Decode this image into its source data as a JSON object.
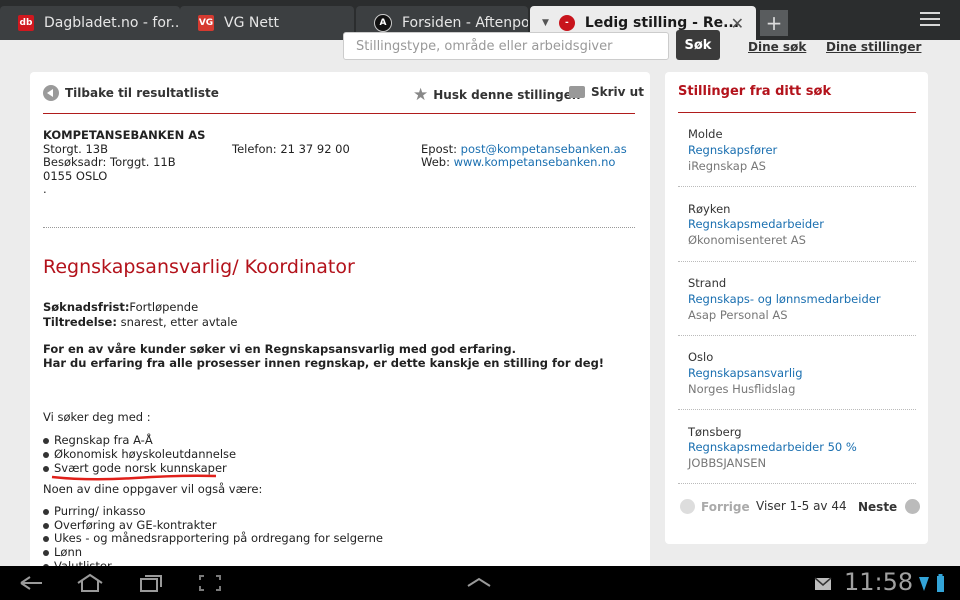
{
  "browser": {
    "tabs": [
      {
        "label": "Dagbladet.no - for...",
        "favicon": "db"
      },
      {
        "label": "VG Nett",
        "favicon": "VG"
      },
      {
        "label": "Forsiden - Aftenpo...",
        "favicon": "A"
      },
      {
        "label": "Ledig stilling - Re...",
        "favicon": "-"
      }
    ]
  },
  "search": {
    "placeholder": "Stillingstype, område eller arbeidsgiver",
    "button": "Søk"
  },
  "toplinks": {
    "dine_sok": "Dine søk",
    "dine_stillinger": "Dine stillinger"
  },
  "toolbar": {
    "back": "Tilbake til resultatliste",
    "remember": "Husk denne stillingen",
    "print": "Skriv ut"
  },
  "company": {
    "name": "KOMPETANSEBANKEN AS",
    "address1": "Storgt. 13B",
    "address2": "Besøksadr: Torggt. 11B",
    "address3": "0155 OSLO",
    "address4": ".",
    "phone_label": "Telefon: 21 37 92 00",
    "email_label": "Epost:",
    "email": "post@kompetansebanken.as",
    "web_label": "Web:",
    "web": "www.kompetansebanken.no"
  },
  "job": {
    "title": "Regnskapsansvarlig/ Koordinator",
    "deadline_label": "Søknadsfrist:",
    "deadline": "Fortløpende",
    "start_label": "Tiltredelse:",
    "start": " snarest, etter avtale",
    "intro1": "For en av våre kunder  søker vi en Regnskapsansvarlig med god erfaring.",
    "intro2": "Har du erfaring fra alle prosesser innen regnskap, er dette kanskje en stilling for deg!",
    "seeking_label": "Vi søker deg med :",
    "requirements": [
      "Regnskap fra A-Å",
      "Økonomisk høyskoleutdannelse",
      "Svært gode norsk kunnskaper"
    ],
    "tasks_label": "Noen av dine oppgaver vil også være:",
    "tasks": [
      "Purring/ inkasso",
      "Overføring av GE-kontrakter",
      "Ukes - og månedsrapportering på ordregang for selgerne",
      "Lønn",
      "Valutlister"
    ]
  },
  "sidebar": {
    "title": "Stillinger fra ditt søk",
    "items": [
      {
        "place": "Molde",
        "title": "Regnskapsfører",
        "company": "iRegnskap AS"
      },
      {
        "place": "Røyken",
        "title": "Regnskapsmedarbeider",
        "company": "Økonomisenteret AS"
      },
      {
        "place": "Strand",
        "title": "Regnskaps- og lønnsmedarbeider",
        "company": "Asap Personal AS"
      },
      {
        "place": "Oslo",
        "title": "Regnskapsansvarlig",
        "company": "Norges Husflidslag"
      },
      {
        "place": "Tønsberg",
        "title": "Regnskapsmedarbeider 50 %",
        "company": "JOBBSJANSEN"
      }
    ],
    "prev": "Forrige",
    "range": "Viser 1-5 av 44",
    "next": "Neste"
  },
  "system": {
    "clock": "11:58"
  },
  "colors": {
    "accent_red": "#b3121b",
    "link_blue": "#1a6fb0"
  }
}
